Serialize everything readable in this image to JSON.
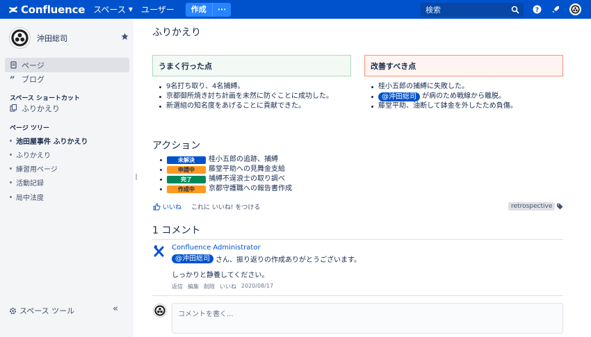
{
  "header": {
    "app_name": "Confluence",
    "nav": {
      "spaces": "スペース",
      "users": "ユーザー"
    },
    "create_label": "作成",
    "create_more": "···",
    "search_placeholder": "検索"
  },
  "sidebar": {
    "space_name": "沖田総司",
    "items": [
      {
        "label": "ページ",
        "icon": "page-icon",
        "active": true
      },
      {
        "label": "ブログ",
        "icon": "quote-icon",
        "active": false
      }
    ],
    "shortcuts_heading": "スペース ショートカット",
    "shortcut": "ふりかえり",
    "tree_heading": "ページ ツリー",
    "tree": [
      "池田屋事件 ふりかえり",
      "ふりかえり",
      "練習用ページ",
      "活動記録",
      "局中法度"
    ],
    "space_tools": "スペース ツール",
    "collapse": "«"
  },
  "page": {
    "title": "ふりかえり",
    "good": {
      "heading": "うまく行った点",
      "items": [
        "9名打ち取り、4名捕縛。",
        "京都御所焼き討ち計画を未然に防ぐことに成功した。",
        "新選組の知名度をあげることに貢献できた。"
      ]
    },
    "bad": {
      "heading": "改善すべき点",
      "item1": "桂小五郎の捕縛に失敗した。",
      "item2_mention": "@沖田総司",
      "item2_text": "が病のため戦線から離脱。",
      "item3": "藤堂平助、油断して鉢金を外したため負傷。"
    },
    "actions_heading": "アクション",
    "actions": [
      {
        "status": "未解決",
        "text": "桂小五郎の追跡、捕縛"
      },
      {
        "status": "申請中",
        "text": "藤堂平助への見舞金支給"
      },
      {
        "status": "完了",
        "text": "捕縛不逞浪士の取り調べ"
      },
      {
        "status": "作成中",
        "text": "京都守護職への報告書作成"
      }
    ],
    "like": "いいね",
    "like_prompt": "これに いいね! をつける",
    "label": "retrospective"
  },
  "comments": {
    "heading": "1 コメント",
    "author": "Confluence Administrator",
    "mention": "@沖田総司",
    "line1_text": "さん、振り返りの作成ありがとうございます。",
    "line2": "しっかりと静養してください。",
    "meta": [
      "返信",
      "編集",
      "削除",
      "いいね",
      "2020/08/17"
    ],
    "input_placeholder": "コメントを書く..."
  },
  "colors": {
    "header": "#0052cc",
    "create": "#2684ff",
    "good_panel": "#f3f9f4",
    "bad_panel": "#fff4f2"
  }
}
